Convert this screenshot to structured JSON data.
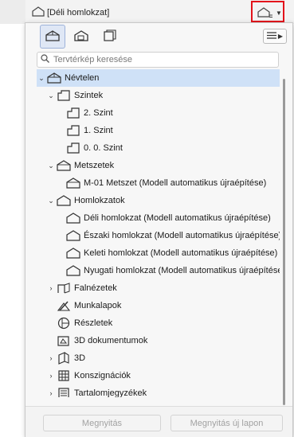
{
  "header": {
    "view_title": "[Déli homlokzat]",
    "current_view_icon": "elevation-icon",
    "dropdown_icon": "caret-down-icon",
    "highlight_color": "#e3131b"
  },
  "panel": {
    "modes": [
      {
        "icon": "project-map-icon",
        "active": true
      },
      {
        "icon": "view-map-icon",
        "active": false
      },
      {
        "icon": "layout-book-icon",
        "active": false
      }
    ],
    "menu_icon": "options-menu-icon",
    "search": {
      "placeholder": "Tervtérkép keresése",
      "value": ""
    },
    "tree": [
      {
        "label": "Névtelen",
        "icon": "project-root-icon",
        "twisty": "open",
        "selected": true
      },
      {
        "label": "Szintek",
        "icon": "stories-icon",
        "twisty": "open"
      },
      {
        "label": "2. Szint",
        "icon": "story-icon"
      },
      {
        "label": "1. Szint",
        "icon": "story-icon"
      },
      {
        "label": "0. 0. Szint",
        "icon": "story-icon"
      },
      {
        "label": "Metszetek",
        "icon": "sections-icon",
        "twisty": "open"
      },
      {
        "label": "M-01 Metszet (Modell automatikus újraépítése)",
        "icon": "section-icon"
      },
      {
        "label": "Homlokzatok",
        "icon": "elevations-icon",
        "twisty": "open"
      },
      {
        "label": "Déli homlokzat (Modell automatikus újraépítése)",
        "icon": "elevation-icon"
      },
      {
        "label": "Északi homlokzat (Modell automatikus újraépítése)",
        "icon": "elevation-icon"
      },
      {
        "label": "Keleti homlokzat (Modell automatikus újraépítése)",
        "icon": "elevation-icon"
      },
      {
        "label": "Nyugati homlokzat (Modell automatikus újraépítése)",
        "icon": "elevation-icon"
      },
      {
        "label": "Falnézetek",
        "icon": "interior-elevations-icon",
        "twisty": "closed"
      },
      {
        "label": "Munkalapok",
        "icon": "worksheets-icon"
      },
      {
        "label": "Részletek",
        "icon": "details-icon"
      },
      {
        "label": "3D dokumentumok",
        "icon": "3d-documents-icon"
      },
      {
        "label": "3D",
        "icon": "3d-icon",
        "twisty": "closed"
      },
      {
        "label": "Konszignációk",
        "icon": "schedules-icon",
        "twisty": "closed"
      },
      {
        "label": "Tartalomjegyzékek",
        "icon": "indexes-icon",
        "twisty": "closed"
      }
    ],
    "footer": {
      "open_label": "Megnyitás",
      "open_new_tab_label": "Megnyitás új lapon"
    }
  }
}
